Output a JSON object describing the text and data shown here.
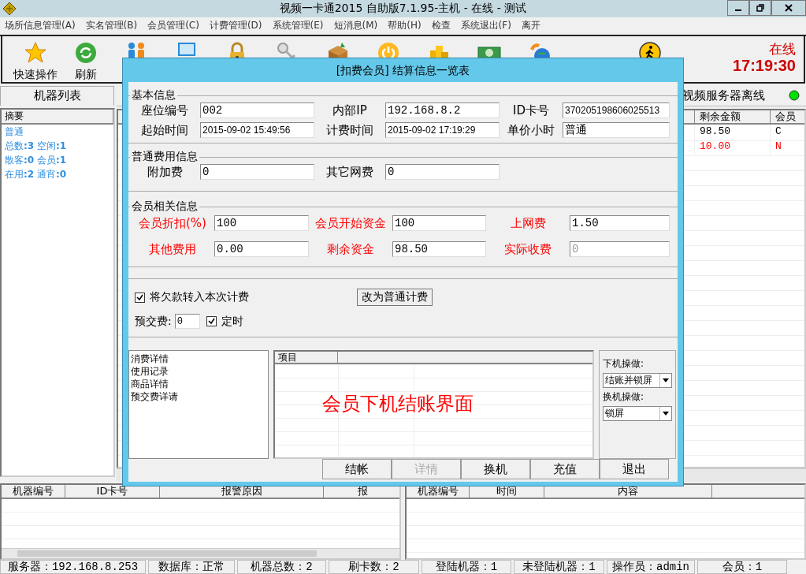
{
  "window": {
    "title": "视频一卡通2015 自助版7.1.95-主机 - 在线 - 测试"
  },
  "menu": [
    "场所信息管理(A)",
    "实名管理(B)",
    "会员管理(C)",
    "计费管理(D)",
    "系统管理(E)",
    "短消息(M)",
    "帮助(H)",
    "检查",
    "系统退出(F)",
    "离开"
  ],
  "toolbar": [
    {
      "label": "快速操作"
    },
    {
      "label": "刷新"
    }
  ],
  "connection": {
    "status": "在线",
    "time": "17:19:30"
  },
  "machine_list": {
    "tab": "机器列表",
    "header": "摘要",
    "items": [
      "普通",
      "总数**:3** 空闲**:1**",
      "散客**:0** 会员**:1**",
      "在用**:2** 通宵**:0**"
    ]
  },
  "machine_table": {
    "notice": "视频服务器离线",
    "columns": [
      "剩余金额",
      "会员"
    ],
    "rows": [
      {
        "balance": "98.50",
        "member": "C",
        "highlight": false
      },
      {
        "balance": "10.00",
        "member": "N",
        "highlight": true
      }
    ]
  },
  "dialog": {
    "title": "[扣费会员] 结算信息一览表",
    "basic": {
      "title": "基本信息",
      "fields": [
        {
          "label": "座位编号",
          "value": "002"
        },
        {
          "label": "内部IP",
          "value": "192.168.8.2"
        },
        {
          "label": "ID卡号",
          "value": "370205198606025513"
        },
        {
          "label": "起始时间",
          "value": "2015-09-02 15:49:56"
        },
        {
          "label": "计费时间",
          "value": "2015-09-02 17:19:29"
        },
        {
          "label": "单价小时",
          "value": "普通"
        }
      ]
    },
    "fees": {
      "title": "普通费用信息",
      "fields": [
        {
          "label": "附加费",
          "value": "0"
        },
        {
          "label": "其它网费",
          "value": "0"
        }
      ]
    },
    "member": {
      "title": "会员相关信息",
      "fields": [
        {
          "label": "会员折扣(%)",
          "value": "100",
          "disabled": false
        },
        {
          "label": "会员开始资金",
          "value": "100",
          "disabled": false
        },
        {
          "label": "上网费",
          "value": "1.50",
          "disabled": false
        },
        {
          "label": "其他费用",
          "value": "0.00",
          "disabled": false
        },
        {
          "label": "剩余资金",
          "value": "98.50",
          "disabled": false
        },
        {
          "label": "实际收费",
          "value": "0",
          "disabled": true
        }
      ]
    },
    "transfer_debt": {
      "label": "将欠款转入本次计费",
      "checked": true
    },
    "switch_button": "改为普通计费",
    "prepay": {
      "label": "预交费:",
      "value": "0"
    },
    "timed": {
      "label": "定时",
      "checked": true
    },
    "detail_list": [
      "消费详情",
      "使用记录",
      "商品详情",
      "预交费详请"
    ],
    "detail_columns": [
      "项目"
    ],
    "caption": "会员下机结账界面",
    "operations": [
      {
        "label": "下机操做:",
        "value": "结账并锁屏"
      },
      {
        "label": "换机操做:",
        "value": "锁屏"
      }
    ],
    "buttons": [
      {
        "label": "结帐",
        "disabled": false
      },
      {
        "label": "详情",
        "disabled": true
      },
      {
        "label": "换机",
        "disabled": false
      },
      {
        "label": "充值",
        "disabled": false
      },
      {
        "label": "退出",
        "disabled": false
      }
    ]
  },
  "alarm_table": {
    "columns": [
      "机器编号",
      "ID卡号",
      "报警原因",
      "报"
    ]
  },
  "message_table": {
    "columns": [
      "机器编号",
      "时间",
      "内容"
    ]
  },
  "status_bar": [
    "服务器：192.168.8.253",
    "数据库：正常",
    "机器总数：2",
    "刷卡数：2",
    "登陆机器：1",
    "未登陆机器：1",
    "操作员：admin",
    "会员：1"
  ]
}
